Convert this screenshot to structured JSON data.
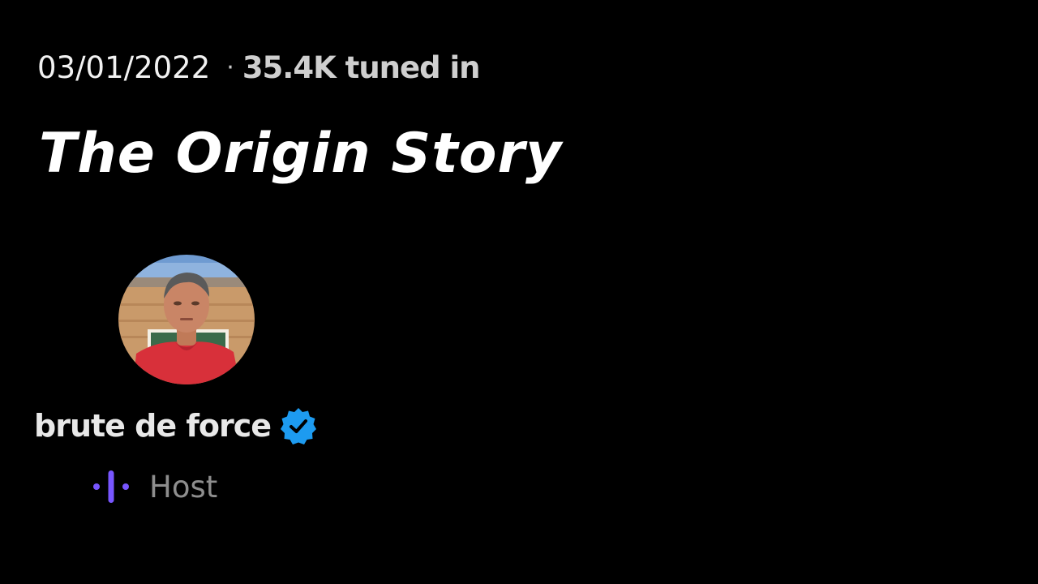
{
  "space": {
    "date": "03/01/2022",
    "separator": "·",
    "listeners": "35.4K tuned in",
    "title": "The Origin Story"
  },
  "host": {
    "name": "brute de force",
    "role": "Host",
    "verified_icon": "verified-badge-icon",
    "role_icon": "audio-bars-icon"
  },
  "colors": {
    "background": "#000000",
    "title": "#ffffff",
    "verified": "#1d9bf0",
    "role_icon": "#7856ff",
    "role_label": "#8e8e8e"
  }
}
